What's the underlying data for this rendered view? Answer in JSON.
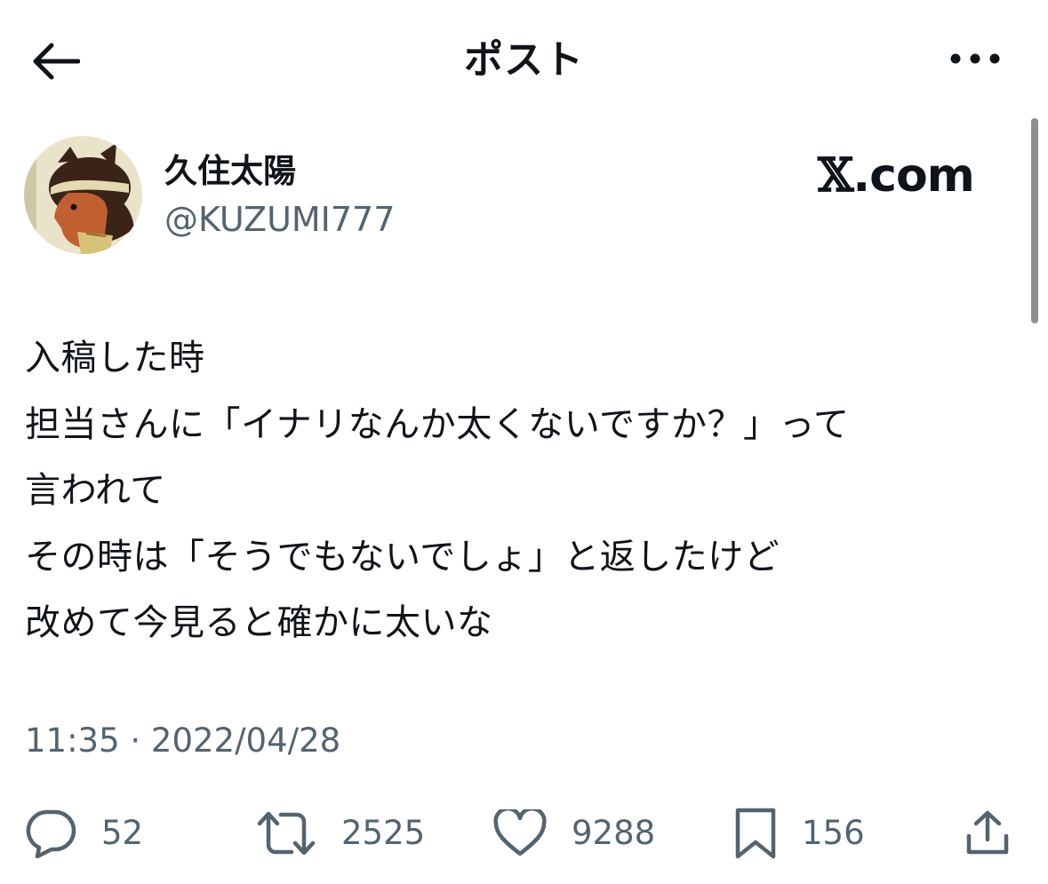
{
  "header": {
    "title": "ポスト",
    "back_icon": "arrow-left-icon",
    "more_icon": "more-horizontal-icon"
  },
  "author": {
    "display_name": "久住太陽",
    "handle": "@KUZUMI777"
  },
  "watermark": {
    "x_mark": "𝕏",
    "domain": ".com"
  },
  "post": {
    "lines": [
      "入稿した時",
      "担当さんに「イナリなんか太くないですか？」って",
      "言われて",
      "その時は「そうでもないでしょ」と返したけど",
      "改めて今見ると確かに太いな"
    ],
    "timestamp": "11:35 · 2022/04/28"
  },
  "actions": {
    "replies": "52",
    "reposts": "2525",
    "likes": "9288",
    "bookmarks": "156"
  },
  "colors": {
    "text": "#0f1419",
    "secondary": "#536471",
    "icon": "#536471",
    "scrollbar": "#8e8e93"
  }
}
